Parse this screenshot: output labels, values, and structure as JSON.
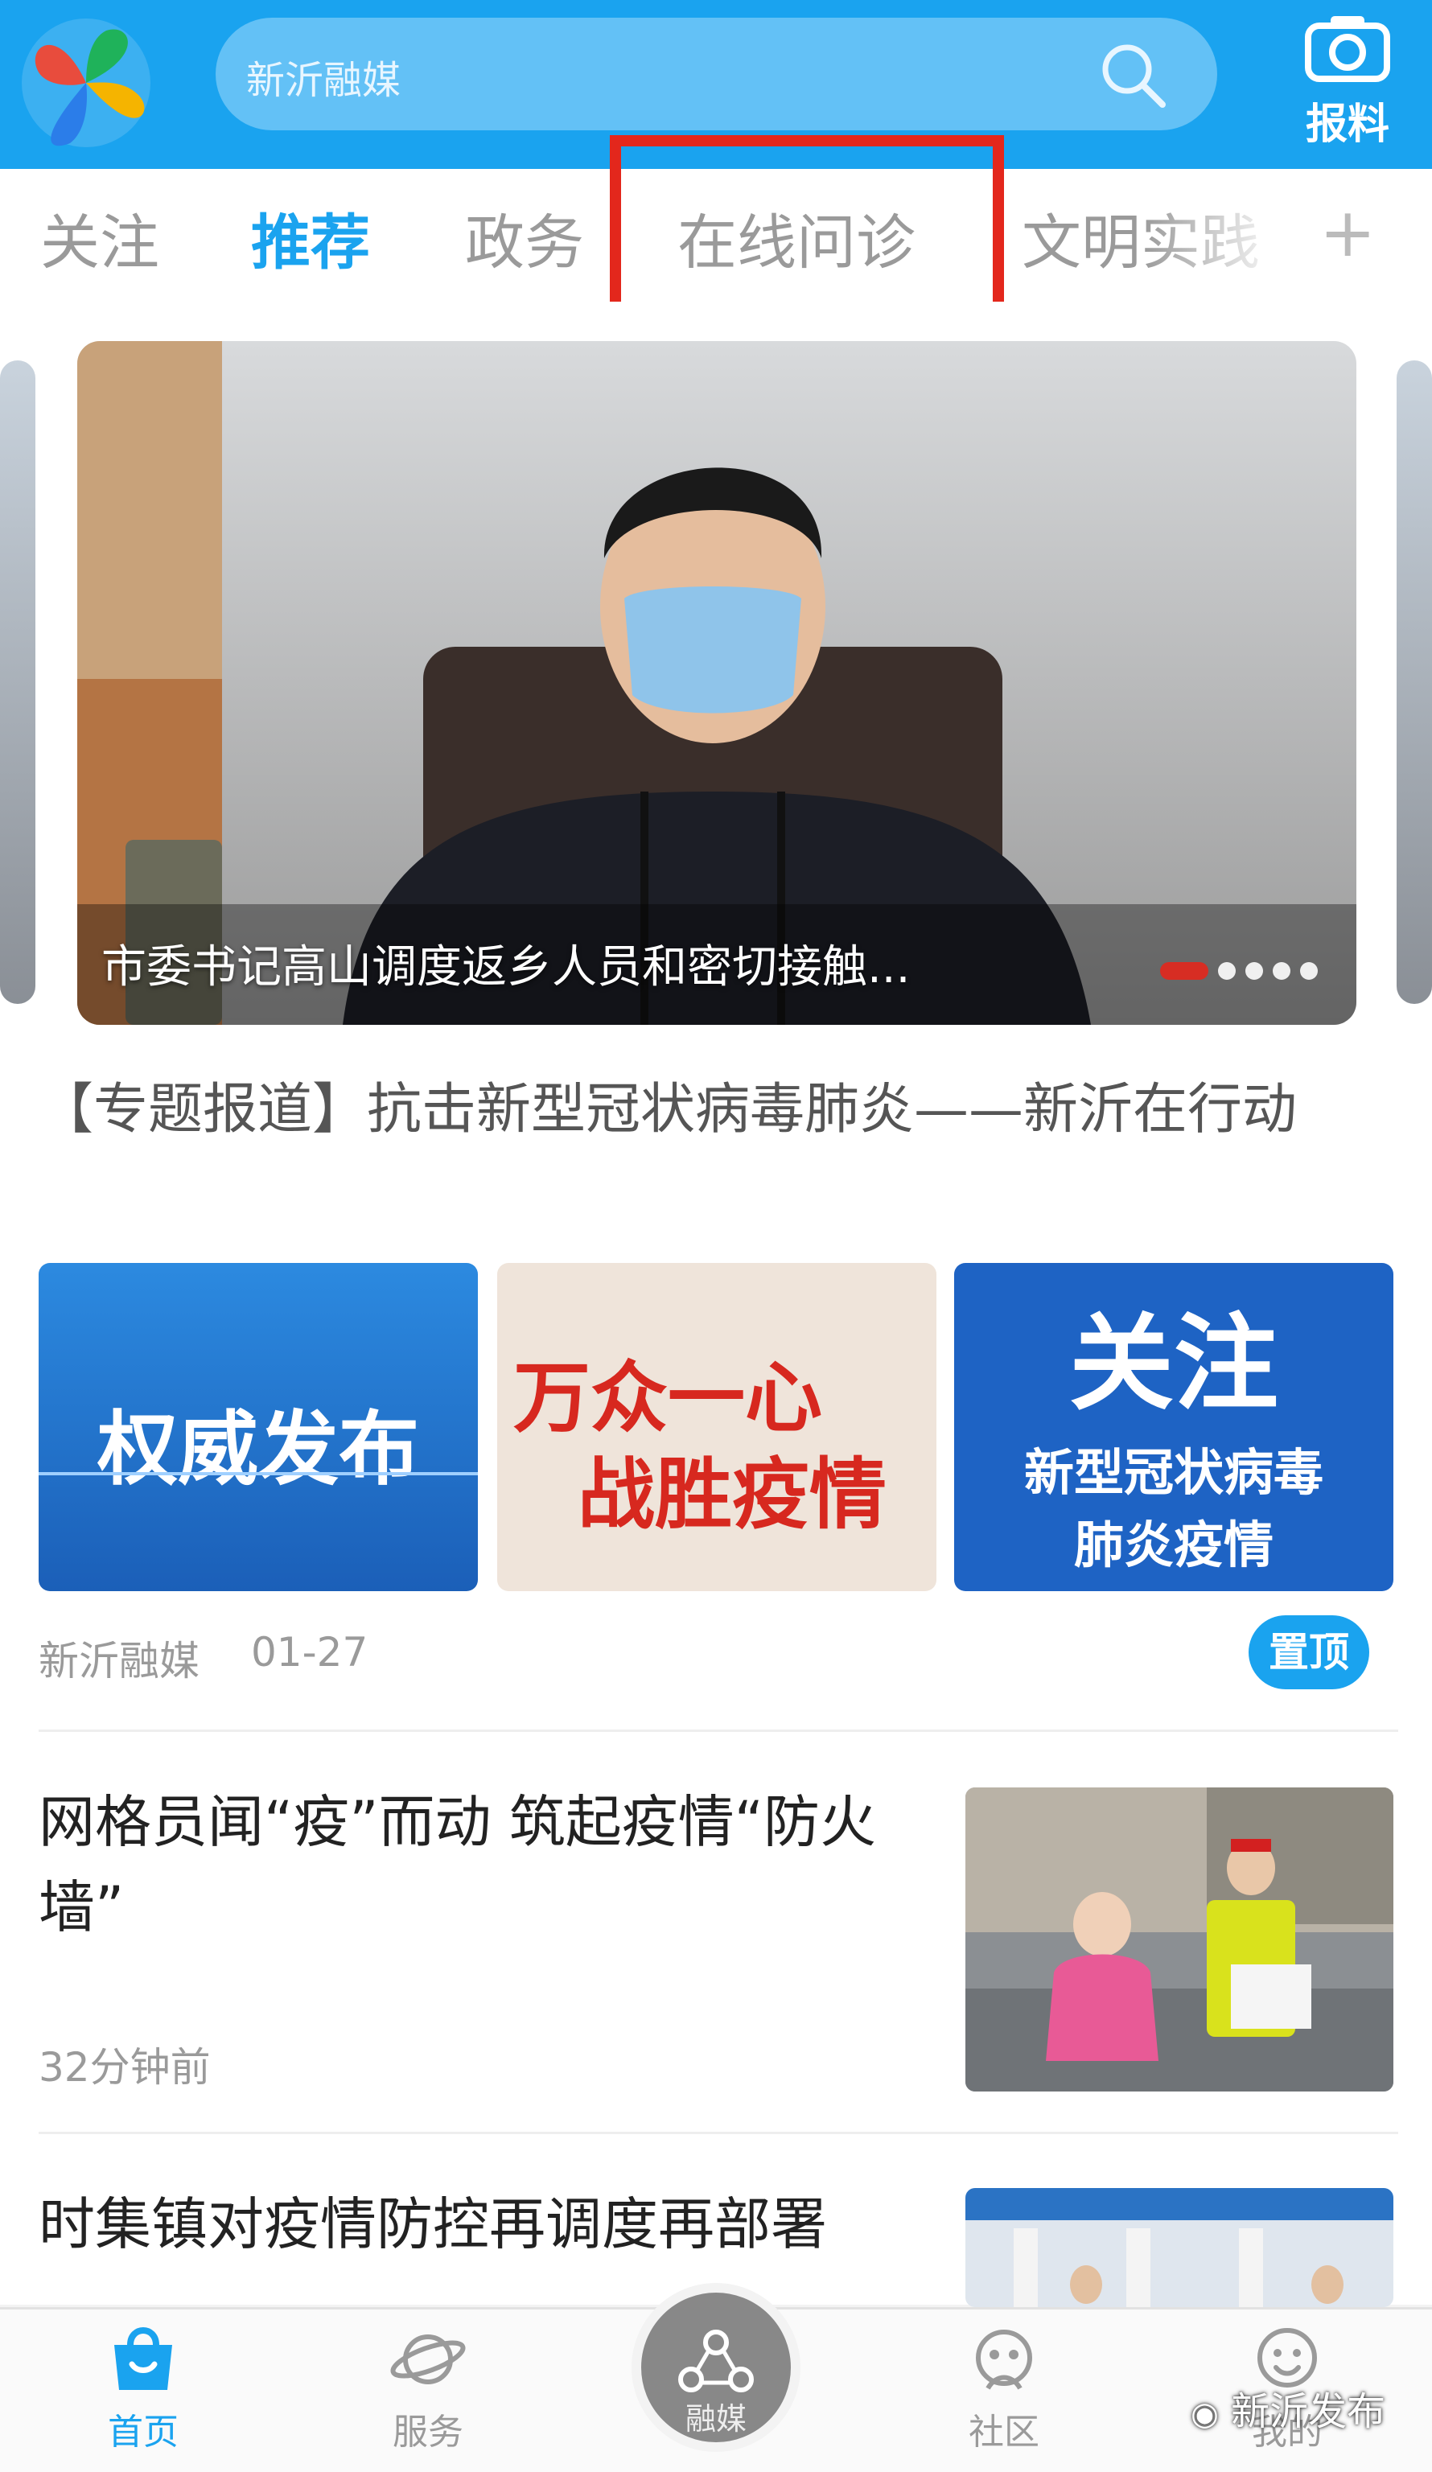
{
  "header": {
    "search_placeholder": "新沂融媒",
    "report_label": "报料"
  },
  "tabs": [
    {
      "label": "关注"
    },
    {
      "label": "推荐"
    },
    {
      "label": "政务"
    },
    {
      "label": "在线问诊"
    },
    {
      "label": "文明实践"
    }
  ],
  "tabs_more": "+",
  "banner": {
    "caption": "市委书记高山调度返乡人员和密切接触..."
  },
  "topic": {
    "title": "【专题报道】抗击新型冠状病毒肺炎——新沂在行动",
    "tiles": [
      {
        "text": "权威发布",
        "bg": "#1d6ec9"
      },
      {
        "text_line1": "万众一心",
        "text_line2": "战胜疫情",
        "bg": "#efe4da"
      },
      {
        "line1": "关注",
        "line2": "新型冠状病毒",
        "line3": "肺炎疫情",
        "bg": "#1e63c4"
      }
    ],
    "source": "新沂融媒",
    "date": "01-27",
    "pin_label": "置顶"
  },
  "news": [
    {
      "title": "网格员闻“疫”而动 筑起疫情“防火墙”",
      "time": "32分钟前"
    },
    {
      "title": "时集镇对疫情防控再调度再部署"
    }
  ],
  "bottom_nav": [
    {
      "label": "首页"
    },
    {
      "label": "服务"
    },
    {
      "label": "融媒"
    },
    {
      "label": "社区"
    },
    {
      "label": "我的"
    }
  ],
  "watermark": "新沂发布",
  "colors": {
    "brand": "#1aa3ef",
    "highlight_box": "#e3271c"
  }
}
